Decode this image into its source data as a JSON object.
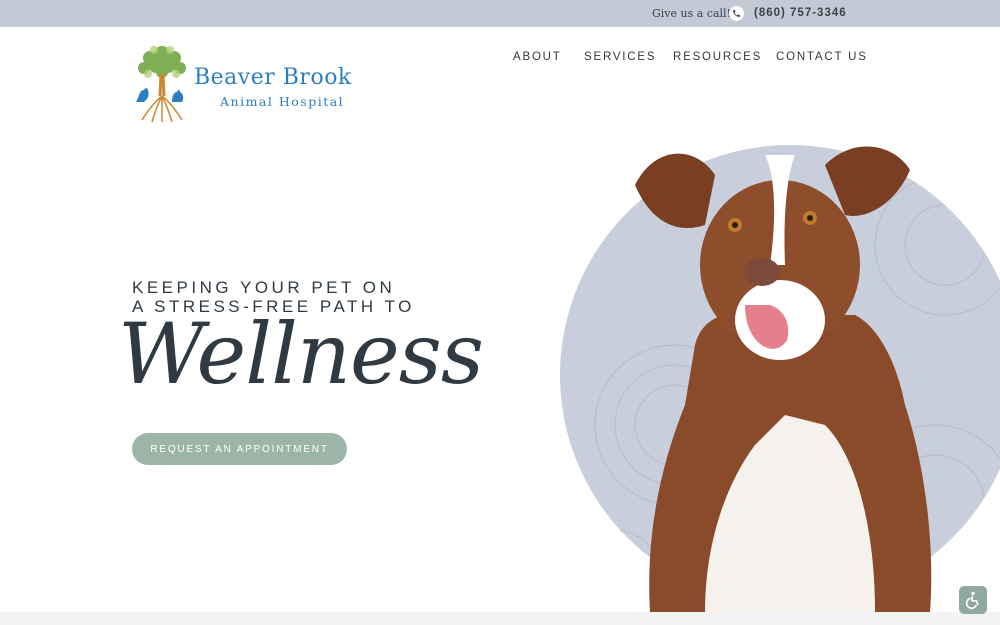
{
  "topbar": {
    "call_text": "Give us a call!",
    "phone_icon": "phone-icon",
    "phone_number": "(860) 757-3346"
  },
  "logo": {
    "line1": "Beaver Brook",
    "line2": "Animal Hospital",
    "icon": "tree-with-pets-logo"
  },
  "nav": {
    "items": [
      "ABOUT",
      "SERVICES",
      "RESOURCES",
      "CONTACT US"
    ]
  },
  "hero": {
    "line1": "KEEPING YOUR PET ON",
    "line2": "A STRESS-FREE PATH TO",
    "script": "Wellness",
    "cta_label": "REQUEST AN APPOINTMENT",
    "image": "border-collie-dog-on-circle"
  },
  "accessibility": {
    "icon": "wheelchair-icon"
  },
  "colors": {
    "topbar": "#c3cad5",
    "brand_blue": "#2c7fc1",
    "text": "#2f3a42",
    "cta": "#9db5a9",
    "circle": "#c8cedb"
  }
}
